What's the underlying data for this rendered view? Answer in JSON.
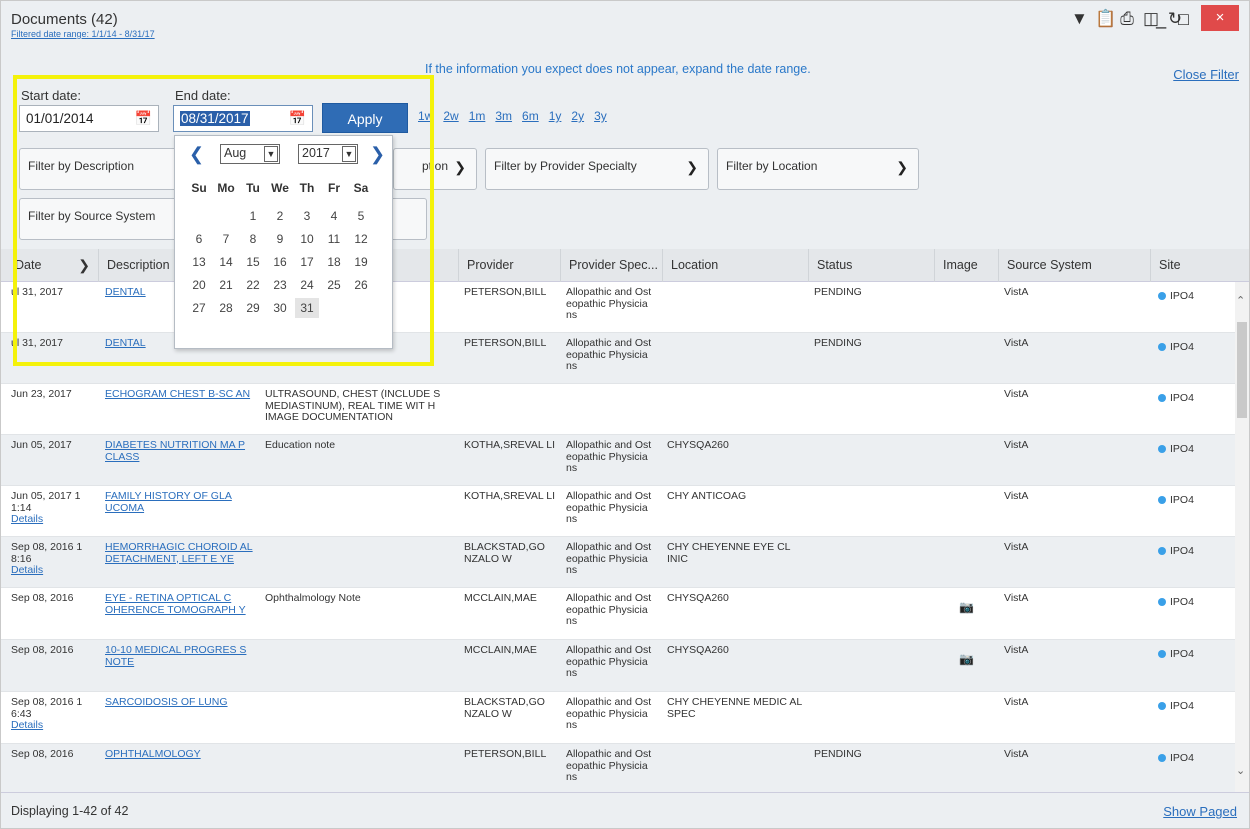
{
  "window": {
    "title": "Documents (42)",
    "filtered_range": "Filtered date range: 1/1/14 - 8/31/17",
    "close_label": "×"
  },
  "toolbar": {
    "icons": [
      "filter-icon",
      "clipboard-icon",
      "print-icon",
      "columns-icon",
      "refresh-icon"
    ]
  },
  "filter": {
    "notice": "If the information you expect does not appear, expand the date range.",
    "close_filter": "Close Filter",
    "start_label": "Start date:",
    "start_value": "01/01/2014",
    "end_label": "End date:",
    "end_value": "08/31/2017",
    "apply": "Apply",
    "ranges": [
      "1w",
      "2w",
      "1m",
      "3m",
      "6m",
      "1y",
      "2y",
      "3y"
    ],
    "by_description": "Filter by Description",
    "by_description_trunc": "ption",
    "by_provider_specialty": "Filter by Provider Specialty",
    "by_location": "Filter by Location",
    "by_source_system": "Filter by Source System"
  },
  "calendar": {
    "month": "Aug",
    "year": "2017",
    "weekdays": [
      "Su",
      "Mo",
      "Tu",
      "We",
      "Th",
      "Fr",
      "Sa"
    ],
    "days": [
      [
        "",
        "",
        "1",
        "2",
        "3",
        "4",
        "5"
      ],
      [
        "6",
        "7",
        "8",
        "9",
        "10",
        "11",
        "12"
      ],
      [
        "13",
        "14",
        "15",
        "16",
        "17",
        "18",
        "19"
      ],
      [
        "20",
        "21",
        "22",
        "23",
        "24",
        "25",
        "26"
      ],
      [
        "27",
        "28",
        "29",
        "30",
        "31",
        "",
        ""
      ]
    ],
    "current_day": "31"
  },
  "table": {
    "columns": [
      "Date",
      "Description",
      "",
      "Provider",
      "Provider Spec...",
      "Location",
      "Status",
      "Image",
      "Source System",
      "Site"
    ],
    "rows": [
      {
        "date": "ul 31, 2017",
        "details": "",
        "desc": "DENTAL",
        "note": "",
        "provider": "PETERSON,BILL",
        "spec": "Allopathic and Ost eopathic Physicia ns",
        "loc": "",
        "status": "PENDING",
        "image": false,
        "source": "VistA",
        "site": "IPO4"
      },
      {
        "date": "ul 31, 2017",
        "details": "",
        "desc": "DENTAL",
        "note": "",
        "provider": "PETERSON,BILL",
        "spec": "Allopathic and Ost eopathic Physicia ns",
        "loc": "",
        "status": "PENDING",
        "image": false,
        "source": "VistA",
        "site": "IPO4"
      },
      {
        "date": "Jun 23, 2017",
        "details": "",
        "desc": "ECHOGRAM CHEST B-SC AN",
        "note": "ULTRASOUND, CHEST (INCLUDE S MEDIASTINUM), REAL TIME WIT H IMAGE DOCUMENTATION",
        "provider": "",
        "spec": "",
        "loc": "",
        "status": "",
        "image": false,
        "source": "VistA",
        "site": "IPO4"
      },
      {
        "date": "Jun 05, 2017",
        "details": "",
        "desc": "DIABETES NUTRITION MA P CLASS",
        "note": "Education note",
        "provider": "KOTHA,SREVAL LI",
        "spec": "Allopathic and Ost eopathic Physicia ns",
        "loc": "CHYSQA260",
        "status": "",
        "image": false,
        "source": "VistA",
        "site": "IPO4"
      },
      {
        "date": "Jun 05, 2017 1 1:14",
        "details": "Details",
        "desc": "FAMILY HISTORY OF GLA UCOMA",
        "note": "",
        "provider": "KOTHA,SREVAL LI",
        "spec": "Allopathic and Ost eopathic Physicia ns",
        "loc": "CHY ANTICOAG",
        "status": "",
        "image": false,
        "source": "VistA",
        "site": "IPO4"
      },
      {
        "date": "Sep 08, 2016 1 8:16",
        "details": "Details",
        "desc": "HEMORRHAGIC CHOROID AL DETACHMENT, LEFT E YE",
        "note": "",
        "provider": "BLACKSTAD,GO NZALO W",
        "spec": "Allopathic and Ost eopathic Physicia ns",
        "loc": "CHY CHEYENNE EYE CL INIC",
        "status": "",
        "image": false,
        "source": "VistA",
        "site": "IPO4"
      },
      {
        "date": "Sep 08, 2016",
        "details": "",
        "desc": "EYE - RETINA OPTICAL C OHERENCE TOMOGRAPH Y",
        "note": "Ophthalmology Note",
        "provider": "MCCLAIN,MAE",
        "spec": "Allopathic and Ost eopathic Physicia ns",
        "loc": "CHYSQA260",
        "status": "",
        "image": true,
        "source": "VistA",
        "site": "IPO4"
      },
      {
        "date": "Sep 08, 2016",
        "details": "",
        "desc": "10-10 MEDICAL PROGRES S NOTE",
        "note": "",
        "provider": "MCCLAIN,MAE",
        "spec": "Allopathic and Ost eopathic Physicia ns",
        "loc": "CHYSQA260",
        "status": "",
        "image": true,
        "source": "VistA",
        "site": "IPO4"
      },
      {
        "date": "Sep 08, 2016 1 6:43",
        "details": "Details",
        "desc": "SARCOIDOSIS OF LUNG",
        "note": "",
        "provider": "BLACKSTAD,GO NZALO W",
        "spec": "Allopathic and Ost eopathic Physicia ns",
        "loc": "CHY CHEYENNE MEDIC AL SPEC",
        "status": "",
        "image": false,
        "source": "VistA",
        "site": "IPO4"
      },
      {
        "date": "Sep 08, 2016",
        "details": "",
        "desc": "OPHTHALMOLOGY",
        "note": "",
        "provider": "PETERSON,BILL",
        "spec": "Allopathic and Ost eopathic Physicia ns",
        "loc": "",
        "status": "PENDING",
        "image": false,
        "source": "VistA",
        "site": "IPO4"
      }
    ]
  },
  "footer": {
    "displaying": "Displaying 1-42 of 42",
    "show_paged": "Show Paged"
  },
  "colors": {
    "accent": "#2f6cb5",
    "highlight": "#f4f20a",
    "close": "#e04a4a",
    "site_dot": "#3aa0e8"
  }
}
